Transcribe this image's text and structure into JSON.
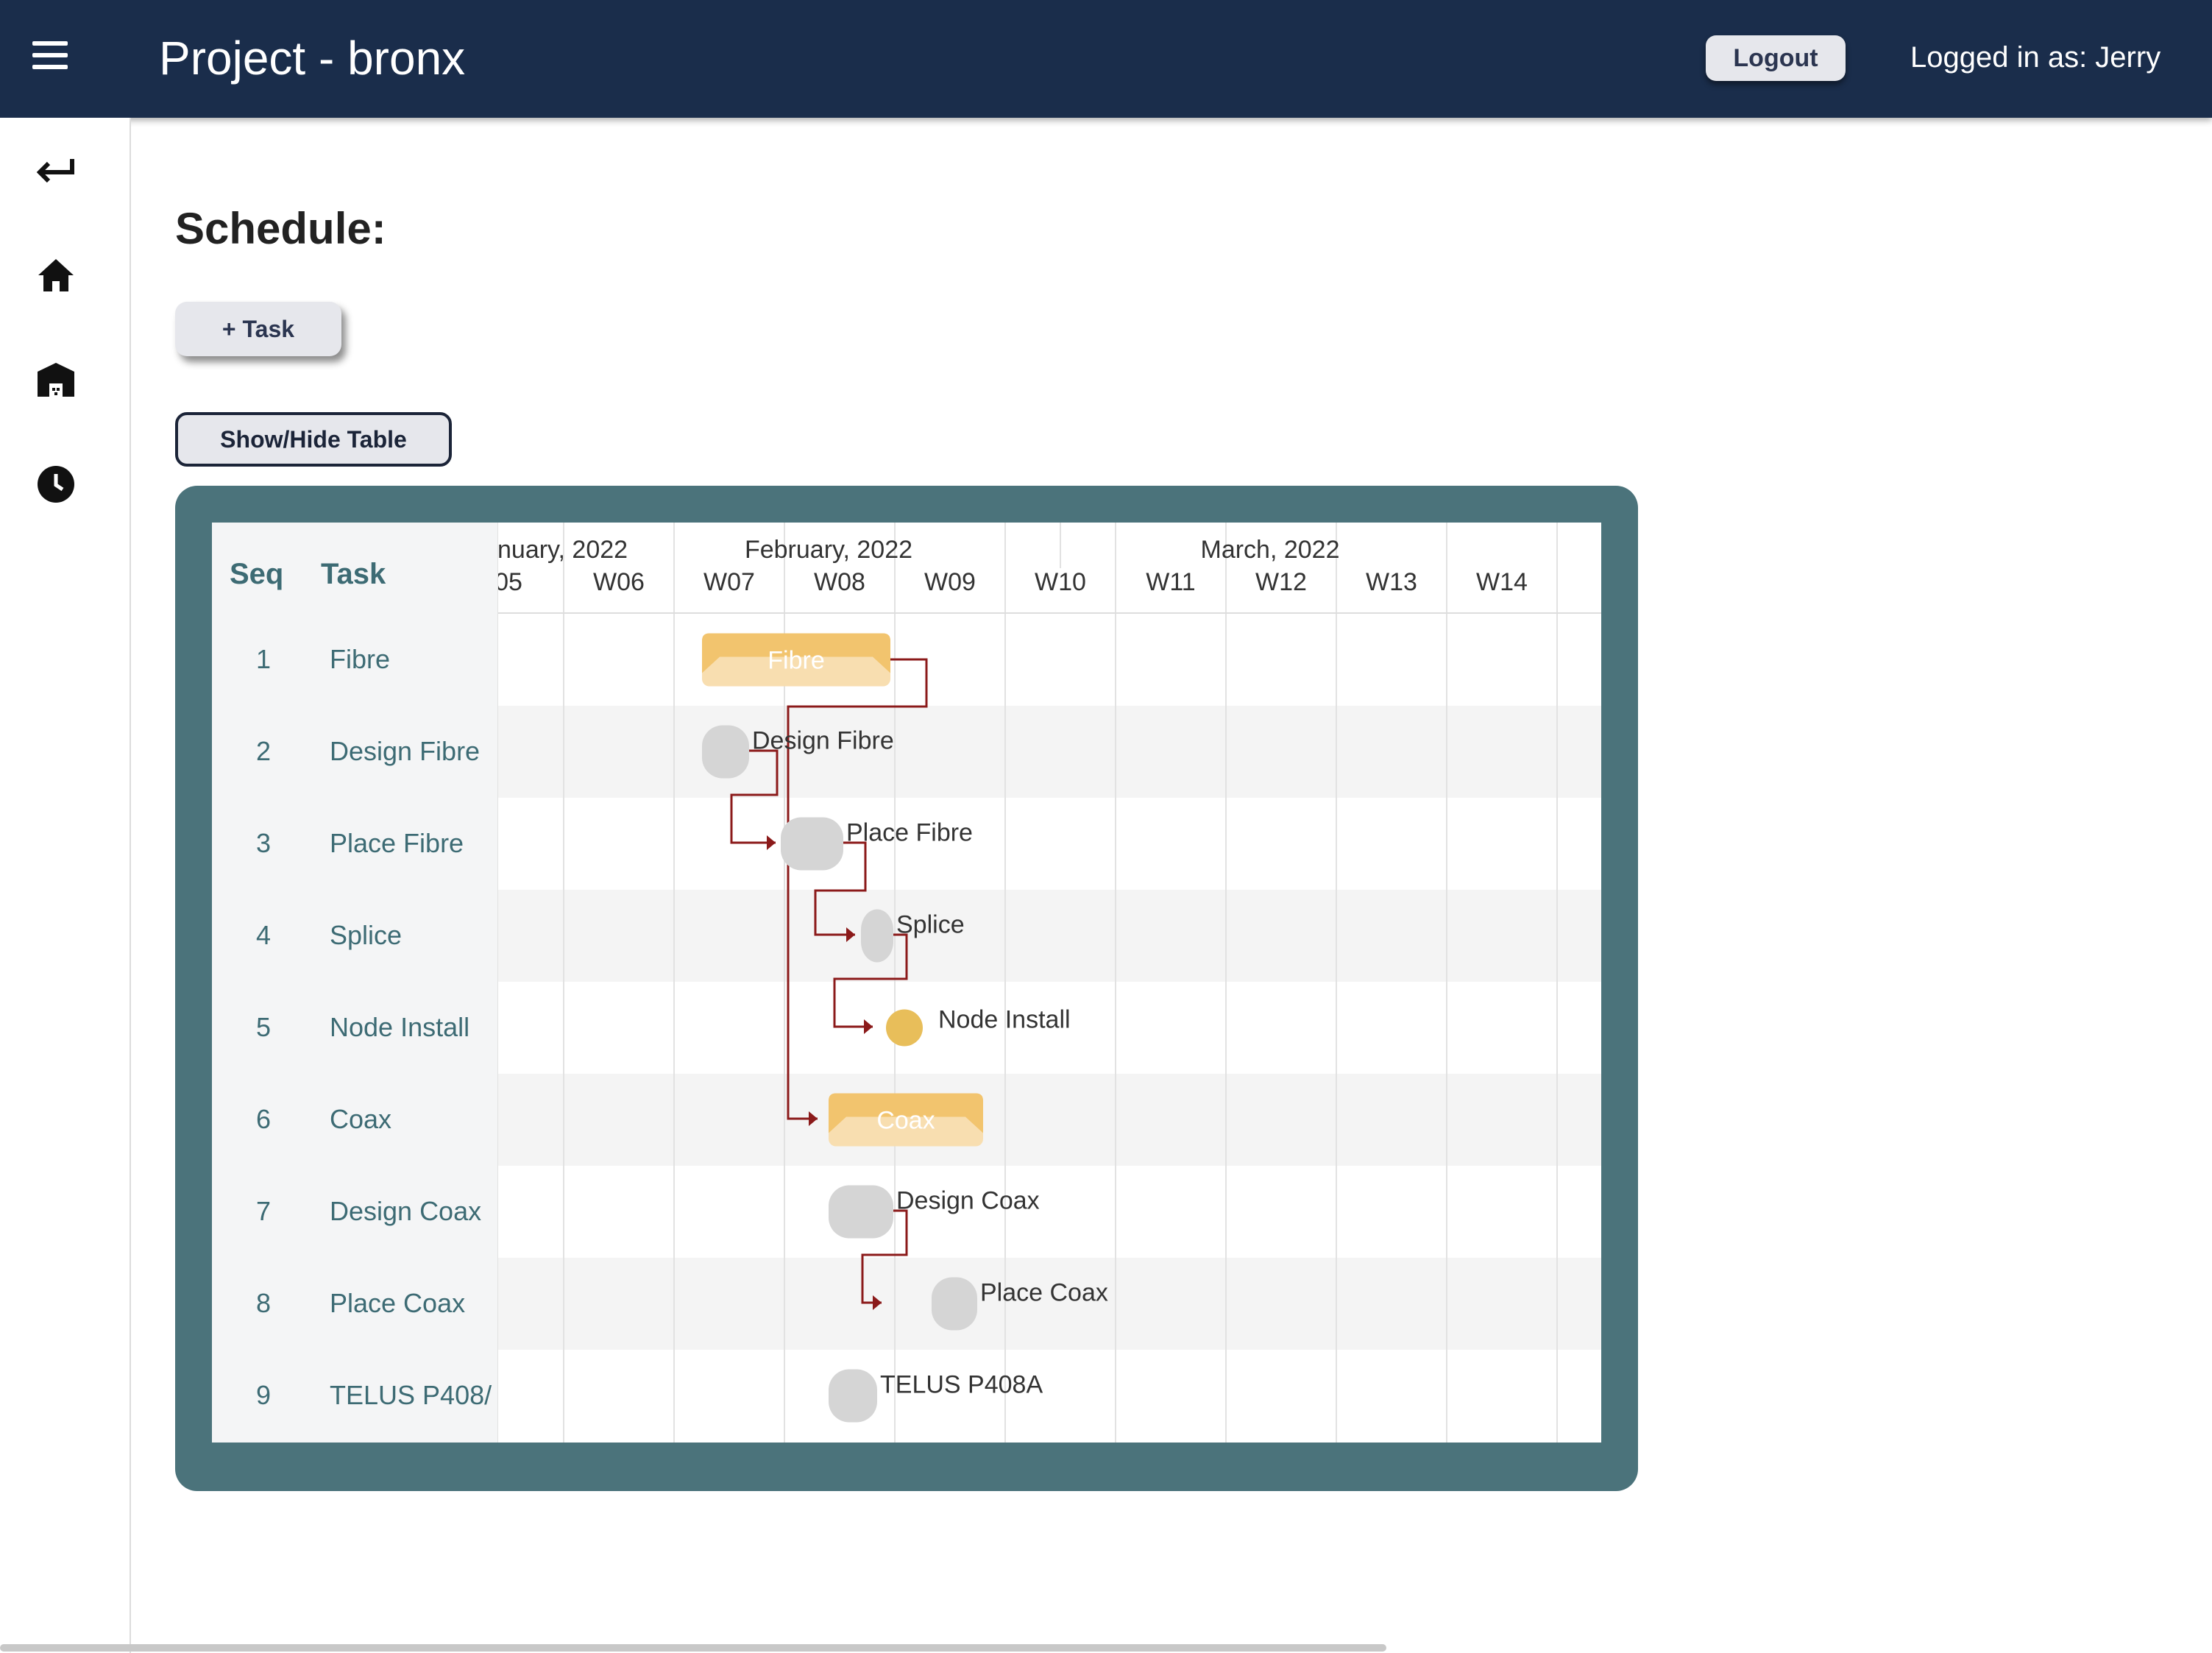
{
  "header": {
    "title": "Project - bronx",
    "logout_label": "Logout",
    "user_label": "Logged in as: Jerry"
  },
  "sidebar": {
    "icons": [
      "back-arrow-icon",
      "home-icon",
      "building-icon",
      "clock-icon"
    ]
  },
  "main": {
    "title": "Schedule:",
    "add_task_label": "+ Task",
    "toggle_table_label": "Show/Hide Table"
  },
  "gantt": {
    "columns": {
      "seq": "Seq",
      "task": "Task"
    },
    "months": [
      "nuary, 2022",
      "February, 2022",
      "March, 2022"
    ],
    "weeks": [
      "05",
      "W06",
      "W07",
      "W08",
      "W09",
      "W10",
      "W11",
      "W12",
      "W13",
      "W14"
    ],
    "rows": [
      {
        "seq": "1",
        "task": "Fibre",
        "bar_label": "Fibre",
        "kind": "summary"
      },
      {
        "seq": "2",
        "task": "Design Fibre",
        "bar_label": "Design Fibre",
        "kind": "task"
      },
      {
        "seq": "3",
        "task": "Place Fibre",
        "bar_label": "Place Fibre",
        "kind": "task"
      },
      {
        "seq": "4",
        "task": "Splice",
        "bar_label": "Splice",
        "kind": "task"
      },
      {
        "seq": "5",
        "task": "Node Install",
        "bar_label": "Node Install",
        "kind": "milestone"
      },
      {
        "seq": "6",
        "task": "Coax",
        "bar_label": "Coax",
        "kind": "summary"
      },
      {
        "seq": "7",
        "task": "Design Coax",
        "bar_label": "Design Coax",
        "kind": "task"
      },
      {
        "seq": "8",
        "task": "Place Coax",
        "bar_label": "Place Coax",
        "kind": "task"
      },
      {
        "seq": "9",
        "task": "TELUS P408/",
        "bar_label": "TELUS P408A",
        "kind": "task"
      }
    ],
    "colors": {
      "summary": "#f2c46e",
      "summary_light": "#f8deb0",
      "task": "#d5d5d5",
      "milestone": "#e8be5a",
      "link": "#8b1a1a",
      "frame": "#4b737b",
      "header_text": "#3d6b74"
    }
  }
}
